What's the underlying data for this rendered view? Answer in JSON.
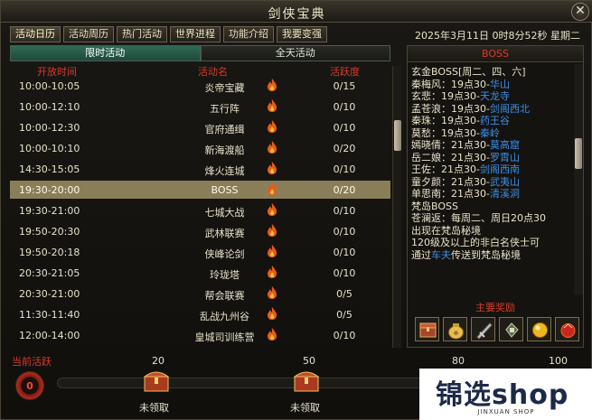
{
  "window": {
    "title": "剑侠宝典",
    "close_label": "✕"
  },
  "top_tabs": [
    {
      "label": "活动日历"
    },
    {
      "label": "活动周历"
    },
    {
      "label": "热门活动"
    },
    {
      "label": "世界进程"
    },
    {
      "label": "功能介绍"
    },
    {
      "label": "我要变强"
    }
  ],
  "datetime": "2025年3月11日 0时8分52秒 星期二",
  "sub_tabs": [
    {
      "label": "限时活动",
      "active": true
    },
    {
      "label": "全天活动",
      "active": false
    }
  ],
  "table": {
    "headers": {
      "time": "开放时间",
      "name": "活动名",
      "activity": "活跃度"
    },
    "rows": [
      {
        "time": "10:00-10:05",
        "name": "炎帝宝藏",
        "activity": "0/15"
      },
      {
        "time": "10:00-12:10",
        "name": "五行阵",
        "activity": "0/10"
      },
      {
        "time": "10:00-12:30",
        "name": "官府通缉",
        "activity": "0/10"
      },
      {
        "time": "10:00-10:10",
        "name": "新海渡船",
        "activity": "0/20"
      },
      {
        "time": "14:30-15:05",
        "name": "烽火连城",
        "activity": "0/10"
      },
      {
        "time": "19:30-20:00",
        "name": "BOSS",
        "activity": "0/20",
        "selected": true
      },
      {
        "time": "19:30-21:00",
        "name": "七城大战",
        "activity": "0/10"
      },
      {
        "time": "19:50-20:30",
        "name": "武林联赛",
        "activity": "0/10"
      },
      {
        "time": "19:50-20:18",
        "name": "侠峰论剑",
        "activity": "0/10"
      },
      {
        "time": "20:30-21:05",
        "name": "玲珑塔",
        "activity": "0/10"
      },
      {
        "time": "20:30-21:00",
        "name": "帮会联赛",
        "activity": "0/5"
      },
      {
        "time": "11:30-11:40",
        "name": "乱战九州谷",
        "activity": "0/5"
      },
      {
        "time": "12:00-14:00",
        "name": "皇城司训练营",
        "activity": "0/10"
      }
    ]
  },
  "detail": {
    "header": "BOSS",
    "lines": [
      {
        "text": "玄金BOSS[周二、四、六]",
        "place": ""
      },
      {
        "text": "秦梅风：19点30-",
        "place": "华山"
      },
      {
        "text": "玄悲：19点30-",
        "place": "天龙寺"
      },
      {
        "text": "孟苍浪：19点30-",
        "place": "剑阁西北"
      },
      {
        "text": "秦珠：19点30-",
        "place": "药王谷"
      },
      {
        "text": "莫愁：19点30-",
        "place": "秦岭"
      },
      {
        "text": "嫣晓倩：21点30-",
        "place": "莫高窟"
      },
      {
        "text": "岳二娘：21点30-",
        "place": "罗霄山"
      },
      {
        "text": "王佐：21点30-",
        "place": "剑阁西南"
      },
      {
        "text": "童夕颜：21点30-",
        "place": "武夷山"
      },
      {
        "text": "单思南：21点30-",
        "place": "清溪洞"
      },
      {
        "text": "梵岛BOSS",
        "place": ""
      },
      {
        "text": "苍澜返：每周二、周日20点30",
        "place": ""
      },
      {
        "text": "出现在梵岛秘境",
        "place": ""
      },
      {
        "text": "120级及以上的非白名侠士可",
        "place": ""
      },
      {
        "text": "通过",
        "place": "车夫",
        "suffix": "传送到梵岛秘境"
      }
    ],
    "rewards_label": "主要奖励"
  },
  "activity_bar": {
    "label": "当前活跃",
    "current": "0",
    "progress": 0,
    "milestones": [
      {
        "value": "20",
        "status": "未领取"
      },
      {
        "value": "50",
        "status": "未领取"
      },
      {
        "value": "80",
        "status": ""
      },
      {
        "value": "100",
        "status": ""
      }
    ]
  },
  "watermark": {
    "main": "锦选shop",
    "sub": "JINXUAN SHOP"
  },
  "colors": {
    "accent_red": "#d83a2a",
    "place_blue": "#3c8ee8",
    "tab_green": "#2f6a55"
  }
}
